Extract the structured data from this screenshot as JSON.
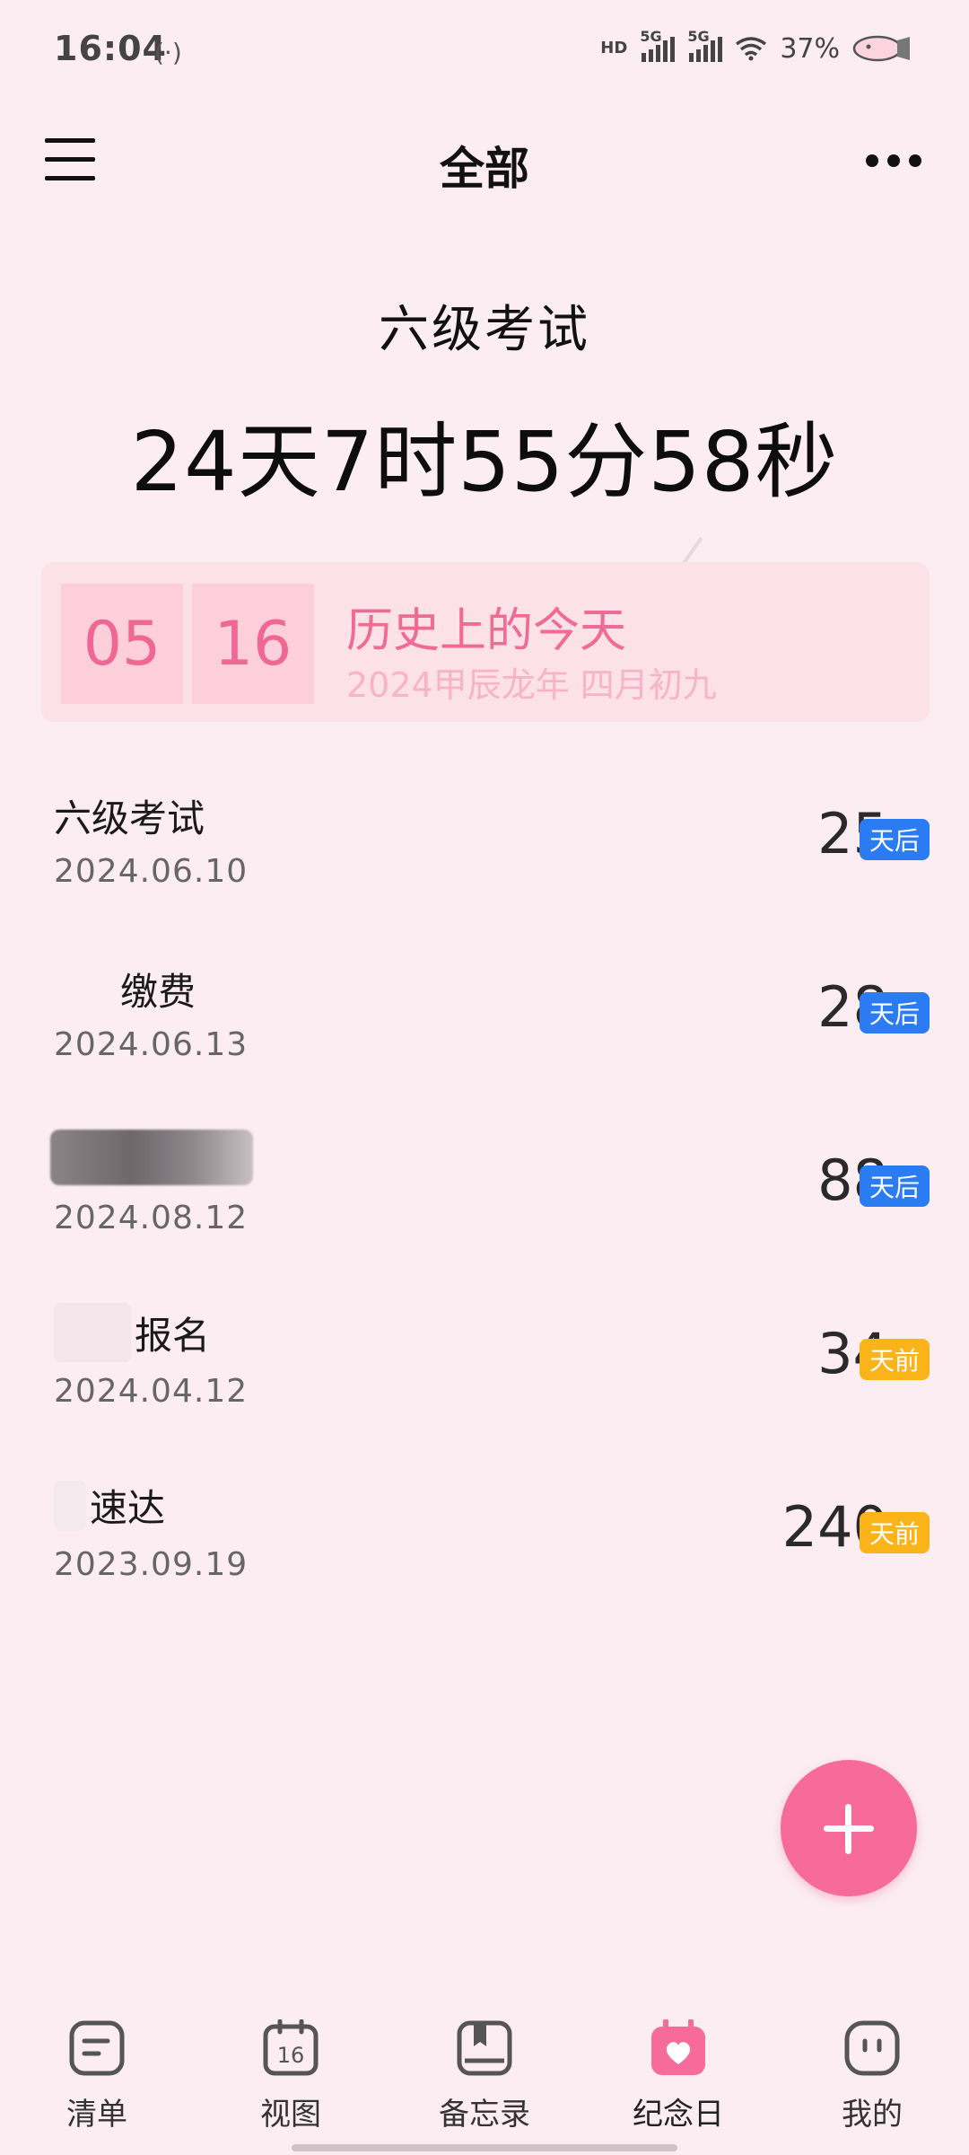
{
  "status_bar": {
    "time": "16:04",
    "hotspot_glyph": "(·)",
    "hd_label": "HD",
    "sim1_label": "5G",
    "sim2_label": "5G",
    "battery_percent": "37%",
    "icons": [
      "hotspot-icon",
      "hd-icon",
      "signal-icon",
      "wifi-icon",
      "battery-icon"
    ]
  },
  "header": {
    "title": "全部",
    "menu_icon": "menu-icon",
    "more_icon": "more-icon"
  },
  "hero": {
    "event_name": "六级考试",
    "countdown": "24天7时55分58秒"
  },
  "today_card": {
    "month": "05",
    "day": "16",
    "title": "历史上的今天",
    "lunar": "2024甲辰龙年 四月初九"
  },
  "events": [
    {
      "name": "六级考试",
      "date": "2024.06.10",
      "count": "25",
      "badge": "天后",
      "badge_color": "#2b7cf2"
    },
    {
      "name": "缴费",
      "date": "2024.06.13",
      "count": "28",
      "badge": "天后",
      "badge_color": "#2b7cf2"
    },
    {
      "name": "",
      "date": "2024.08.12",
      "count": "88",
      "badge": "天后",
      "badge_color": "#2b7cf2"
    },
    {
      "name": "报名",
      "date": "2024.04.12",
      "count": "34",
      "badge": "天前",
      "badge_color": "#fbb31a"
    },
    {
      "name": "速达",
      "date": "2023.09.19",
      "count": "240",
      "badge": "天前",
      "badge_color": "#fbb31a"
    }
  ],
  "fab": {
    "icon": "plus-icon",
    "color": "#f66b9a"
  },
  "bottom_nav": {
    "items": [
      {
        "label": "清单",
        "icon": "list-icon"
      },
      {
        "label": "视图",
        "icon": "calendar-icon",
        "icon_text": "16"
      },
      {
        "label": "备忘录",
        "icon": "notebook-icon"
      },
      {
        "label": "纪念日",
        "icon": "heart-calendar-icon",
        "active": true
      },
      {
        "label": "我的",
        "icon": "profile-icon"
      }
    ]
  },
  "colors": {
    "background": "#fbedf1",
    "accent": "#f66b9a",
    "badge_future": "#2b7cf2",
    "badge_past": "#fbb31a"
  }
}
